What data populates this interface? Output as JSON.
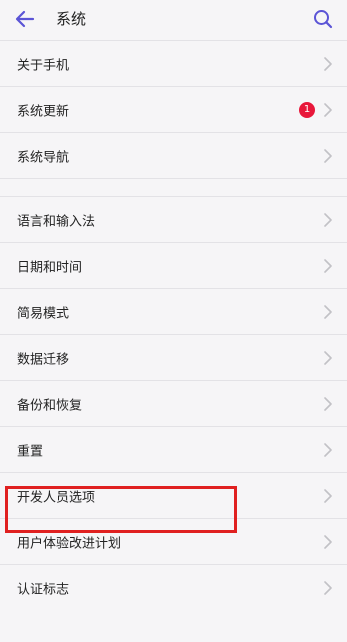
{
  "header": {
    "title": "系统",
    "back_icon": "arrow-left-icon",
    "search_icon": "search-icon"
  },
  "colors": {
    "accent": "#5b54d6",
    "badge": "#e8173a",
    "highlight": "#e02020"
  },
  "items": [
    {
      "label": "关于手机"
    },
    {
      "label": "系统更新",
      "badge": "1"
    },
    {
      "label": "系统导航"
    },
    {
      "label": "语言和输入法"
    },
    {
      "label": "日期和时间"
    },
    {
      "label": "简易模式"
    },
    {
      "label": "数据迁移"
    },
    {
      "label": "备份和恢复"
    },
    {
      "label": "重置"
    },
    {
      "label": "开发人员选项"
    },
    {
      "label": "用户体验改进计划"
    },
    {
      "label": "认证标志"
    }
  ]
}
